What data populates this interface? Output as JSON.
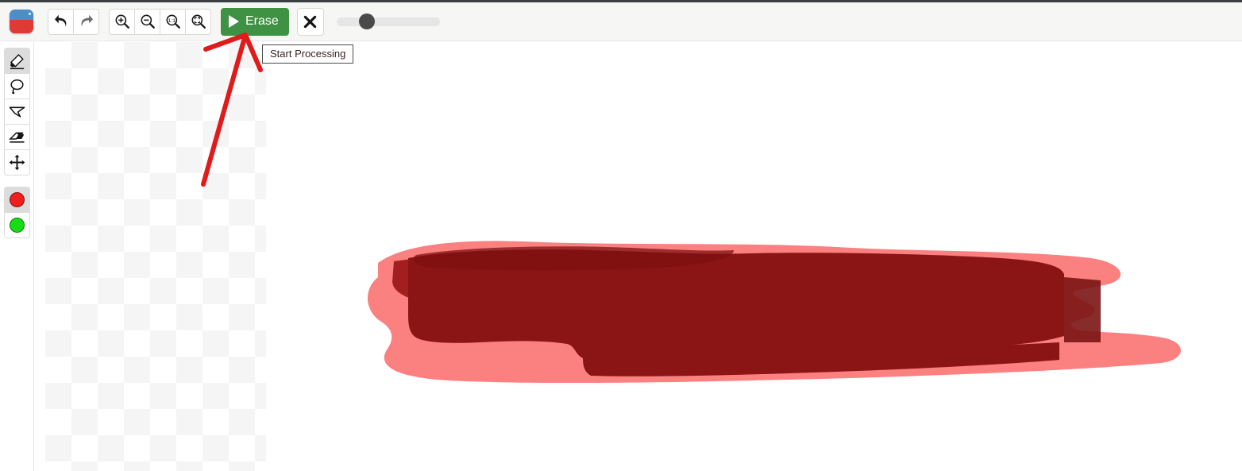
{
  "app": {
    "logo_name": "app-logo",
    "accent_green": "#3f9243",
    "annotation_red": "#e01b1b"
  },
  "toolbar": {
    "undo_label": "Undo",
    "redo_label": "Redo",
    "zoom_in_label": "Zoom In",
    "zoom_out_label": "Zoom Out",
    "zoom_actual_label": "Zoom 1:1",
    "zoom_fit_label": "Zoom To Fit",
    "erase_label": "Erase",
    "cancel_label": "Cancel",
    "slider_value": 22,
    "slider_min": 0,
    "slider_max": 100
  },
  "tooltip": {
    "text": "Start Processing"
  },
  "sidebar": {
    "tools": [
      {
        "name": "brush-tool",
        "label": "Brush",
        "selected": true
      },
      {
        "name": "lasso-tool",
        "label": "Lasso",
        "selected": false
      },
      {
        "name": "polygon-lasso-tool",
        "label": "Polygon Lasso",
        "selected": false
      },
      {
        "name": "eraser-tool",
        "label": "Eraser",
        "selected": false
      },
      {
        "name": "move-tool",
        "label": "Move",
        "selected": false
      }
    ],
    "swatches": [
      {
        "name": "color-swatch-red",
        "label": "Red",
        "color": "#f01e1e",
        "selected": true
      },
      {
        "name": "color-swatch-green",
        "label": "Green",
        "color": "#14dd14",
        "selected": false
      }
    ]
  },
  "canvas": {
    "background": "#ffffff",
    "checker_light": "#ffffff",
    "checker_dark": "#f5f5f5",
    "mask_outer_color": "#fb8080",
    "mask_inner_color": "#8b1414",
    "mask_mid_color": "#a31e1e"
  }
}
